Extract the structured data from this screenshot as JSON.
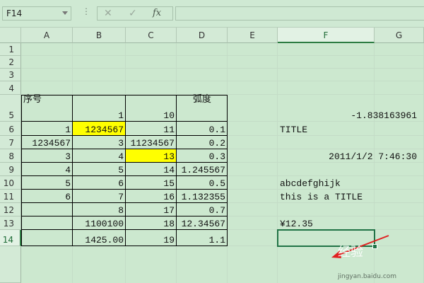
{
  "toolbar": {
    "name_box": "F14",
    "separator": "⋮",
    "cancel": "✕",
    "enter": "✓",
    "fx": "fx",
    "formula_value": ""
  },
  "columns": [
    "A",
    "B",
    "C",
    "D",
    "E",
    "F",
    "G"
  ],
  "selected_column": "F",
  "rows": [
    "1",
    "2",
    "3",
    "4",
    "5",
    "6",
    "7",
    "8",
    "9",
    "10",
    "11",
    "12",
    "13",
    "14"
  ],
  "selected_row": "14",
  "cells": {
    "A5": "序号",
    "B5": "1",
    "C5": "10",
    "D5": "弧度",
    "F5": "-1.838163961",
    "A6": "1",
    "B6": "1234567",
    "C6": "11",
    "D6": "0.1",
    "F6": "TITLE",
    "A7": "1234567",
    "B7": "3",
    "C7": "11234567",
    "D7": "0.2",
    "A8": "3",
    "B8": "4",
    "C8": "13",
    "D8": "0.3",
    "F8": "2011/1/2 7:46:30",
    "A9": "4",
    "B9": "5",
    "C9": "14",
    "D9": "1.245567",
    "A10": "5",
    "B10": "6",
    "C10": "15",
    "D10": "0.5",
    "F10": "abcdefghijk",
    "A11": "6",
    "B11": "7",
    "C11": "16",
    "D11": "1.132355",
    "F11": "this is a TITLE",
    "B12": "8",
    "C12": "17",
    "D12": "0.7",
    "B13": "1100100",
    "C13": "18",
    "D13": "12.34567",
    "F13": "¥12.35",
    "B14": "1425.00",
    "C14": "19",
    "D14": "1.1"
  },
  "highlight_color": "#ffff00",
  "watermark": "经验",
  "watermark_sub": "jingyan.baidu.com"
}
